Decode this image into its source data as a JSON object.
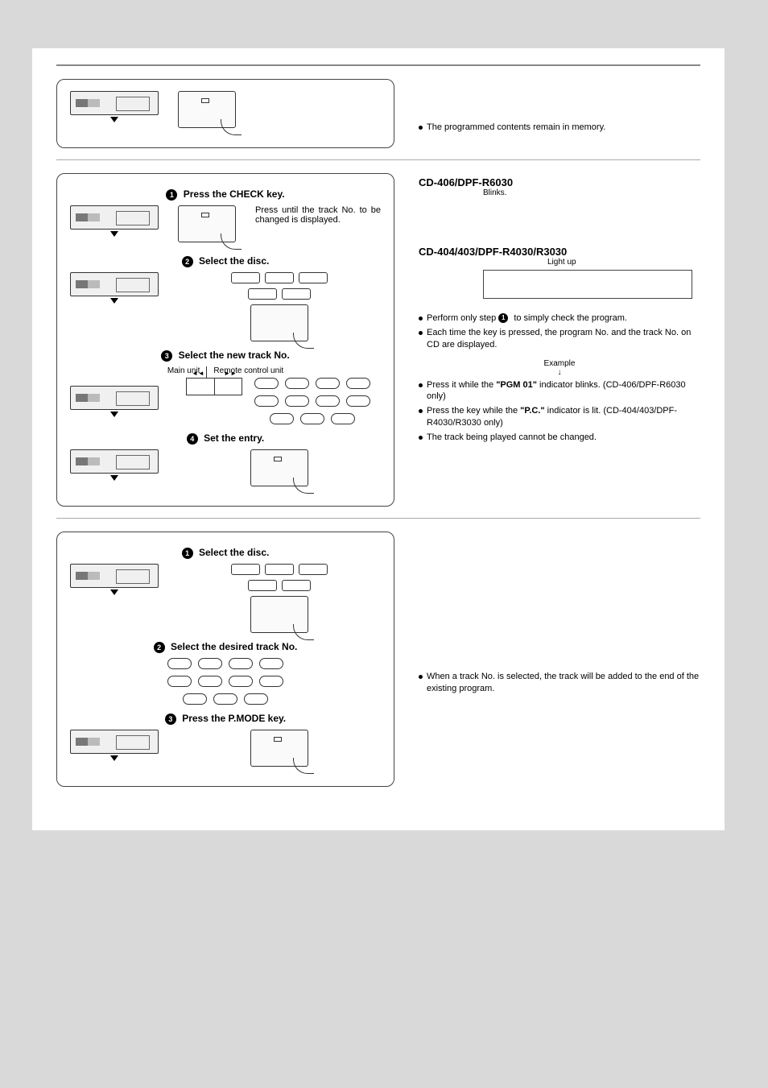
{
  "stop": {
    "note": "The programmed contents remain in memory."
  },
  "change": {
    "step1": "Press the CHECK key.",
    "step1_desc": "Press until the track No. to be changed is displayed.",
    "step2": "Select the disc.",
    "step3": "Select the new track No.",
    "main_unit_label": "Main unit",
    "remote_label": "Remote control unit",
    "step4": "Set the entry.",
    "model_a": "CD-406/DPF-R6030",
    "model_a_note": "Blinks.",
    "model_b": "CD-404/403/DPF-R4030/R3030",
    "model_b_note": "Light up",
    "perform_note_a": "Perform only step",
    "perform_note_b": "to simply check the program.",
    "each_time": "Each time the key is pressed, the program No.  and the track No. on CD are displayed.",
    "example_label": "Example",
    "note_pgm_a": "Press it while the ",
    "note_pgm_bold": "\"PGM 01\"",
    "note_pgm_b": " indicator blinks. (CD-406/DPF-R6030 only)",
    "note_pc_a": "Press the key while the ",
    "note_pc_bold": "\"P.C.\"",
    "note_pc_b": " indicator is lit. (CD-404/403/DPF-R4030/R3030 only)",
    "note_trk": "The track being played cannot be changed."
  },
  "add": {
    "step1": "Select the disc.",
    "step2": "Select the desired track No.",
    "step3": "Press the P.MODE key.",
    "note": "When a track No. is selected, the track will be added  to the end of the existing program."
  }
}
